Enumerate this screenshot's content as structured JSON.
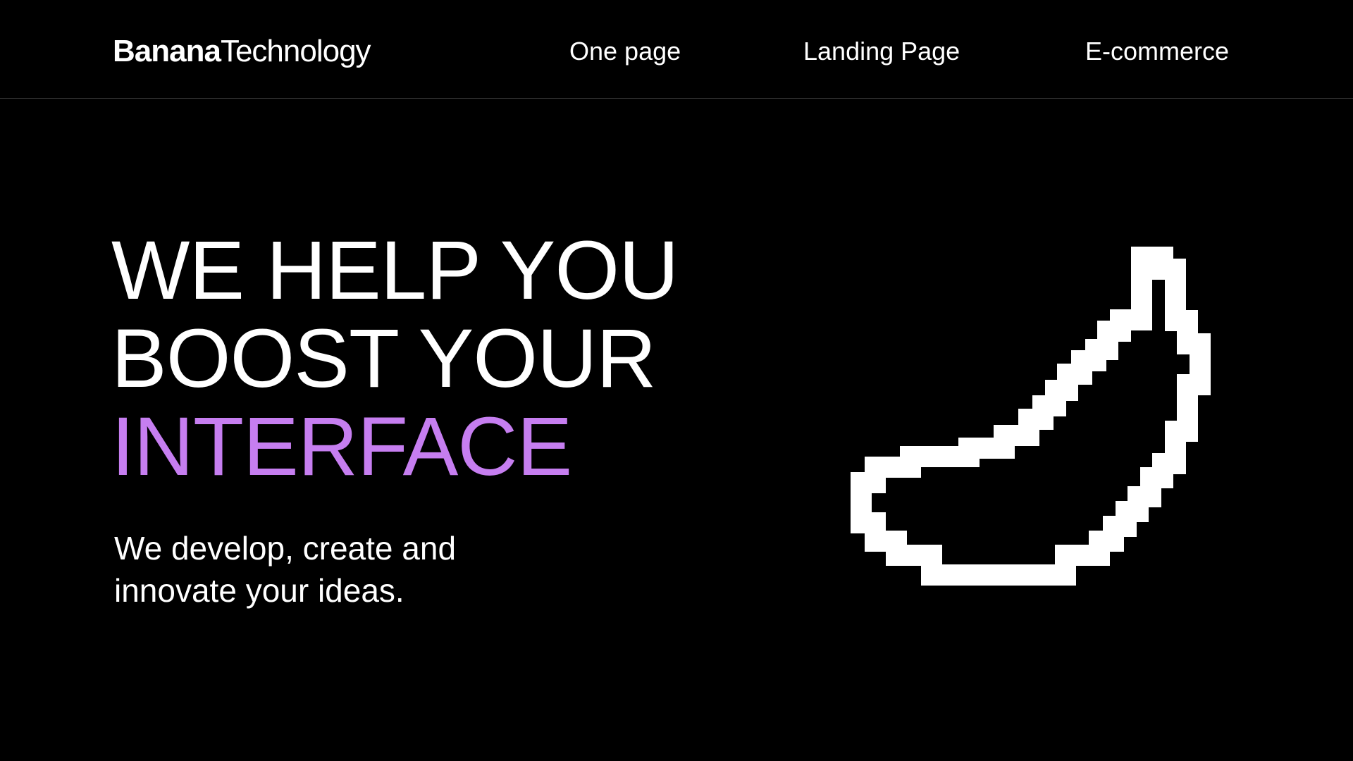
{
  "header": {
    "logo_bold": "Banana",
    "logo_light": "Technology",
    "nav": [
      {
        "label": "One page"
      },
      {
        "label": "Landing Page"
      },
      {
        "label": "E-commerce"
      }
    ]
  },
  "hero": {
    "title_line1": "WE HELP YOU",
    "title_line2": "BOOST YOUR",
    "title_line3": "INTERFACE",
    "subtitle_line1": "We develop, create and",
    "subtitle_line2": "innovate your ideas."
  },
  "colors": {
    "background": "#000000",
    "text": "#ffffff",
    "accent": "#c67ef0",
    "divider": "#3a3a3a"
  },
  "icons": {
    "illustration": "pixel-banana-icon"
  }
}
